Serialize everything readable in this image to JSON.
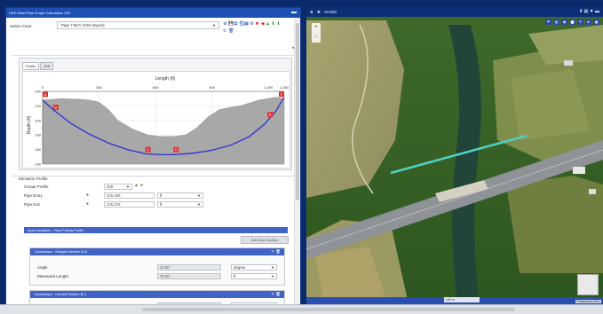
{
  "window": {
    "title": "HDD Steel Pipe Graph Calculation GIS",
    "minimize": "▬"
  },
  "case": {
    "label": "Select Case:",
    "value": "Pipe 7 BAY (GIS Import)",
    "tools": [
      "⚙",
      "💾",
      "⧉",
      "🗒",
      "▦",
      "⚙",
      "✖",
      "◀",
      "▲",
      "⬆",
      "⬇"
    ],
    "tools2": [
      "↻",
      "🗑"
    ],
    "add": "✚"
  },
  "profile": {
    "tabs": [
      "Profile",
      "GIS"
    ],
    "markers": [
      "A",
      "B",
      "C",
      "D",
      "E",
      "F"
    ]
  },
  "chart_data": {
    "type": "line",
    "title": "",
    "xlabel": "Length (ft)",
    "ylabel": "Depth (ft)",
    "xlim": [
      0,
      1284
    ],
    "ylim": [
      140,
      240
    ],
    "xticks": [
      0,
      300,
      600,
      900,
      1200,
      1284
    ],
    "xtick_labels": [
      "0",
      "300",
      "600",
      "900",
      "1,200",
      "1,284"
    ],
    "yticks": [
      240,
      220,
      200,
      180,
      160,
      140
    ],
    "ground": {
      "x": [
        0,
        100,
        200,
        250,
        300,
        350,
        400,
        480,
        560,
        620,
        700,
        760,
        820,
        880,
        940,
        1000,
        1050,
        1100,
        1150,
        1200,
        1240,
        1284
      ],
      "y": [
        228,
        230,
        229,
        228,
        225,
        215,
        200,
        188,
        180,
        178,
        178,
        180,
        190,
        205,
        215,
        218,
        220,
        224,
        228,
        230,
        232,
        230
      ]
    },
    "pipe": {
      "x": [
        0,
        60,
        150,
        250,
        350,
        450,
        550,
        640,
        700,
        800,
        900,
        1000,
        1100,
        1180,
        1240,
        1284
      ],
      "y": [
        228,
        214,
        196,
        181,
        169,
        160,
        154,
        153,
        153,
        155,
        159,
        166,
        178,
        195,
        213,
        232
      ]
    },
    "marker_points": [
      {
        "label": "A",
        "x": 0,
        "y": 236
      },
      {
        "label": "B",
        "x": 70,
        "y": 218
      },
      {
        "label": "C",
        "x": 560,
        "y": 160
      },
      {
        "label": "D",
        "x": 710,
        "y": 160
      },
      {
        "label": "E",
        "x": 1210,
        "y": 208
      },
      {
        "label": "F",
        "x": 1284,
        "y": 236
      }
    ]
  },
  "elevation": {
    "title": "Elevation Profile",
    "create_label": "Create Profile",
    "create_value": "GIS",
    "entry_label": "Pipe Entry",
    "entry_value": "225.289",
    "entry_unit": "ft",
    "exit_label": "Pipe Exit",
    "exit_value": "226.276",
    "exit_unit": "ft"
  },
  "input_vars": {
    "title": "Input Variables - Pipe Pulling Profile",
    "add_button": "Add New Section",
    "sections": [
      {
        "title": "Downslope : Straight Section A-B",
        "rows": [
          {
            "label": "Angle",
            "value": "12.00",
            "unit": "degree"
          },
          {
            "label": "Measured Length",
            "value": "75.00",
            "unit": "ft"
          }
        ]
      },
      {
        "title": "Downslope : Curved Section B-C",
        "rows": [
          {
            "label": "Angle",
            "value": "12.00",
            "unit": "degree"
          }
        ]
      }
    ]
  },
  "map": {
    "title": "ArcGIS",
    "zoom_in": "+",
    "zoom_out": "−",
    "tools": [
      "⚑",
      "▤",
      "◉",
      "⬤",
      "✎",
      "⊕",
      "▣"
    ],
    "right_icons": "⬆ ▤ ▼ ▬",
    "scale": "100 m",
    "powered": "Powered by Esri"
  },
  "colors": {
    "header": "#1e4fb3",
    "section_header": "#3f63c7",
    "pipe_line": "#3030d0",
    "ground_fill": "#a8a8a8",
    "marker": "#e03030",
    "alignment_line": "#4fd1c5"
  }
}
